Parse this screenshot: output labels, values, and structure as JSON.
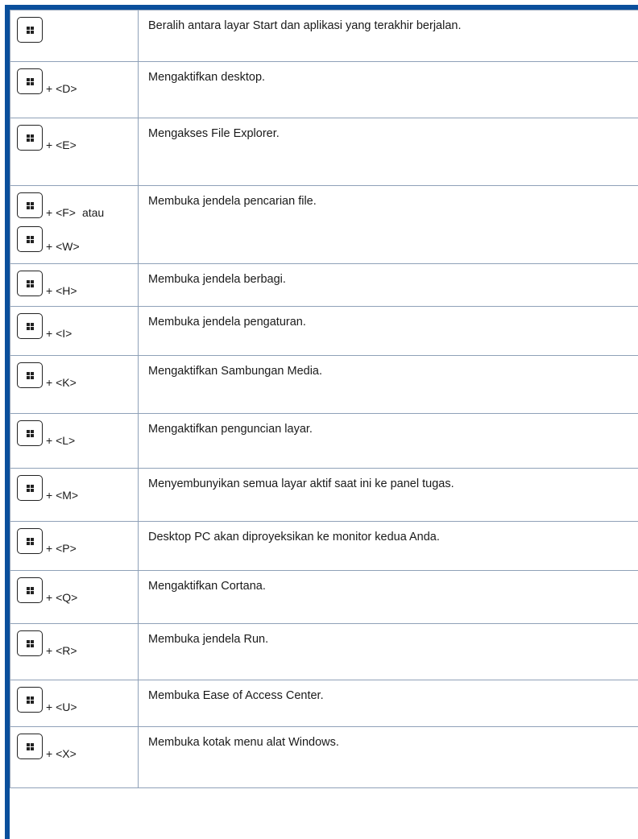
{
  "shortcuts": [
    {
      "keys": [
        {
          "win": true,
          "combo": ""
        }
      ],
      "description": "Beralih antara layar Start dan aplikasi yang terakhir berjalan."
    },
    {
      "keys": [
        {
          "win": true,
          "combo": "+ <D>"
        }
      ],
      "description": "Mengaktifkan desktop."
    },
    {
      "keys": [
        {
          "win": true,
          "combo": "+ <E>"
        }
      ],
      "description": "Mengakses File Explorer."
    },
    {
      "keys": [
        {
          "win": true,
          "combo": "+ <F>",
          "suffix": "atau"
        },
        {
          "win": true,
          "combo": "+ <W>"
        }
      ],
      "description": "Membuka jendela pencarian file."
    },
    {
      "keys": [
        {
          "win": true,
          "combo": "+ <H>"
        }
      ],
      "description": "Membuka jendela berbagi."
    },
    {
      "keys": [
        {
          "win": true,
          "combo": "+ <I>"
        }
      ],
      "description": "Membuka jendela pengaturan."
    },
    {
      "keys": [
        {
          "win": true,
          "combo": "+ <K>"
        }
      ],
      "description": "Mengaktifkan Sambungan Media."
    },
    {
      "keys": [
        {
          "win": true,
          "combo": "+ <L>"
        }
      ],
      "description": "Mengaktifkan penguncian layar."
    },
    {
      "keys": [
        {
          "win": true,
          "combo": "+ <M>"
        }
      ],
      "description": "Menyembunyikan semua layar aktif saat ini ke panel tugas."
    },
    {
      "keys": [
        {
          "win": true,
          "combo": "+ <P>"
        }
      ],
      "description": "Desktop PC akan diproyeksikan ke monitor kedua Anda."
    },
    {
      "keys": [
        {
          "win": true,
          "combo": "+ <Q>"
        }
      ],
      "description": "Mengaktifkan Cortana."
    },
    {
      "keys": [
        {
          "win": true,
          "combo": "+ <R>"
        }
      ],
      "description": "Membuka jendela Run."
    },
    {
      "keys": [
        {
          "win": true,
          "combo": "+ <U>"
        }
      ],
      "description": "Membuka Ease of Access Center."
    },
    {
      "keys": [
        {
          "win": true,
          "combo": "+ <X>"
        }
      ],
      "description": "Membuka kotak menu alat Windows."
    }
  ],
  "colors": {
    "frame_accent": "#0a4f9c",
    "grid_line": "#8fa1b8"
  },
  "icons": {
    "windows_key": "windows-logo-key-icon"
  }
}
